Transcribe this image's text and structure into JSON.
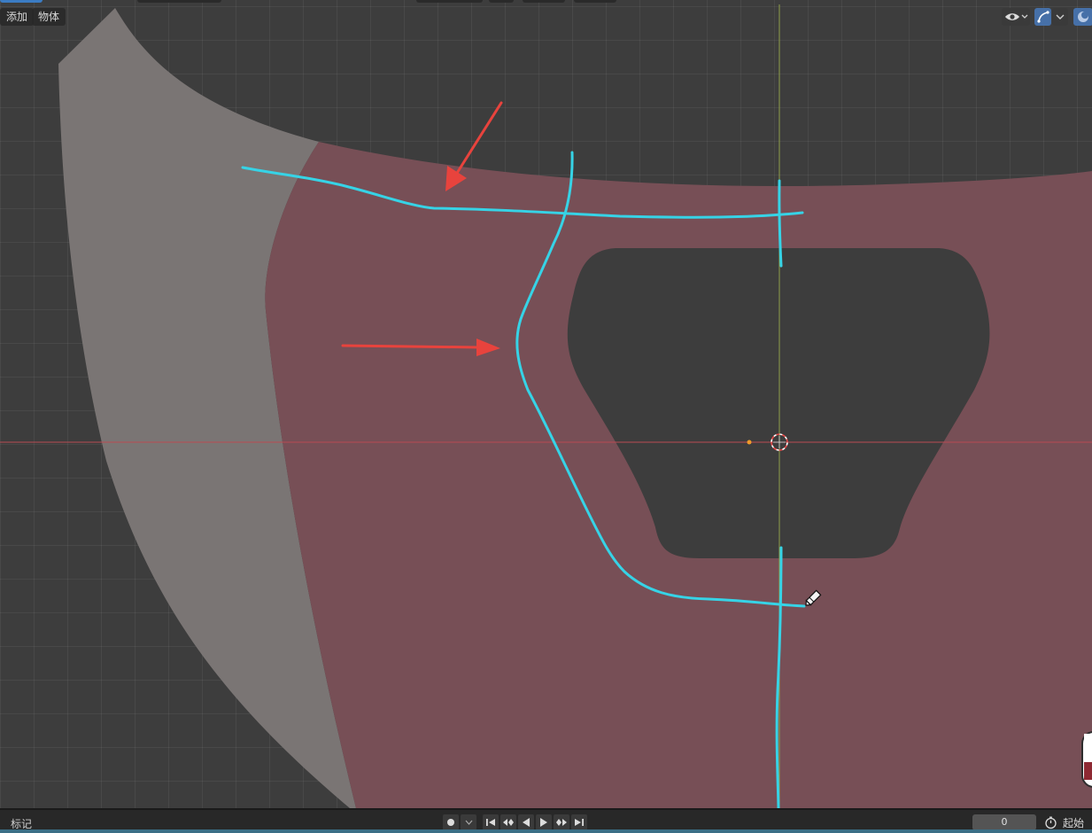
{
  "header": {
    "menu_add": "添加",
    "menu_object": "物体"
  },
  "overlays": {
    "visibility_icon": "eye-icon",
    "gizmo_icon": "gizmo-icon",
    "overlay_icon": "overlay-toggle-icon",
    "chevron_icon": "chevron-down-icon"
  },
  "timeline": {
    "label": "标记",
    "current_frame": "0",
    "start_label": "起始"
  },
  "colors": {
    "viewport_bg": "#3d3d3d",
    "mask_fill": "#774f56",
    "light_shape": "#7a7574",
    "annotation_stroke": "#36d3e6",
    "arrow_color": "#e8433d",
    "x_axis": "#b94a52",
    "y_axis": "#8fa04a"
  }
}
